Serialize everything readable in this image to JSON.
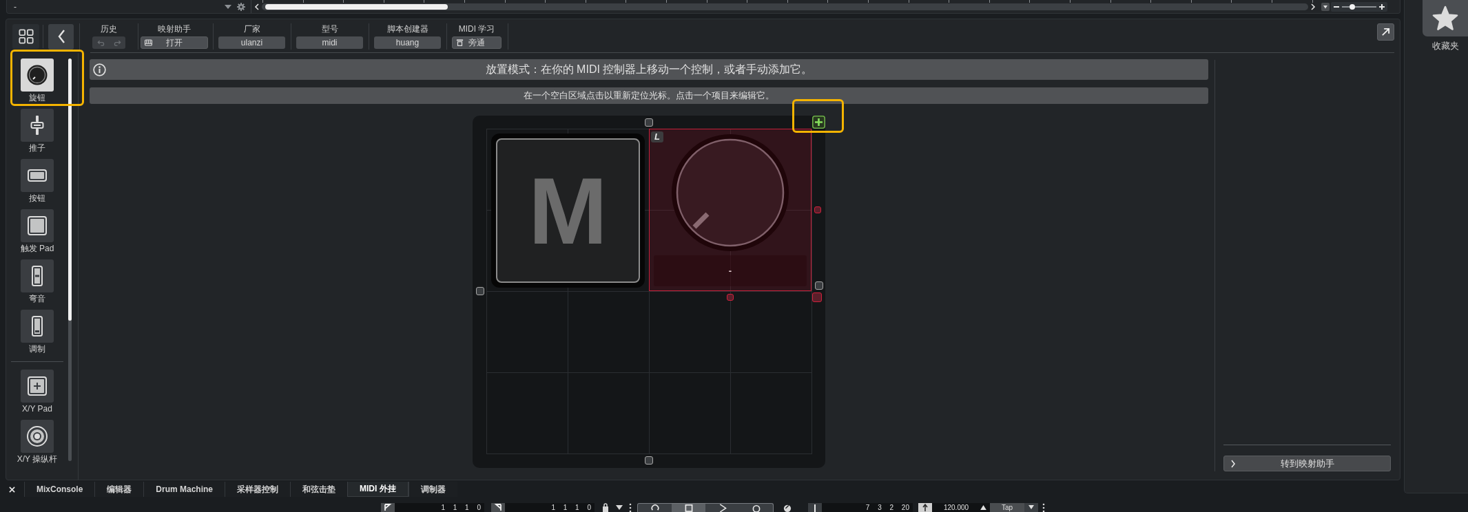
{
  "top_bar": {
    "title": "-",
    "zoom_slider": {
      "level": 0.3
    }
  },
  "favorites": {
    "label": "收藏夹"
  },
  "toolbar": {
    "groups": [
      {
        "kind": "history",
        "label": "历史",
        "disabled": true
      },
      {
        "kind": "launch",
        "label": "映射助手",
        "value": "打开"
      },
      {
        "kind": "field",
        "label": "厂家",
        "value": "ulanzi"
      },
      {
        "kind": "field",
        "label": "型号",
        "value": "midi"
      },
      {
        "kind": "field",
        "label": "脚本创建器",
        "value": "huang"
      },
      {
        "kind": "toggle",
        "label": "MIDI 学习",
        "value": "旁通"
      }
    ]
  },
  "sidebar": {
    "groups": [
      {
        "items": [
          {
            "kind": "knob",
            "label": "旋钮",
            "selected": true,
            "highlighted": true
          },
          {
            "kind": "fader",
            "label": "推子",
            "selected": false,
            "highlighted": false
          },
          {
            "kind": "button",
            "label": "按钮",
            "selected": false,
            "highlighted": false
          },
          {
            "kind": "pad",
            "label": "触发 Pad",
            "selected": false,
            "highlighted": false
          },
          {
            "kind": "pitch",
            "label": "弯音",
            "selected": false,
            "highlighted": false
          },
          {
            "kind": "modulation",
            "label": "调制",
            "selected": false,
            "highlighted": false
          }
        ]
      },
      {
        "items": [
          {
            "kind": "xy-pad",
            "label": "X/Y Pad",
            "selected": false,
            "highlighted": false
          },
          {
            "kind": "joystick",
            "label": "X/Y 操纵杆",
            "selected": false,
            "highlighted": false
          }
        ]
      }
    ]
  },
  "info": {
    "message": "放置模式：在你的 MIDI 控制器上移动一个控制，或者手动添加它。",
    "hint": "在一个空白区域点击以重新定位光标。点击一个项目来编辑它。"
  },
  "canvas": {
    "add_button": {
      "highlighted": true
    },
    "controls": [
      {
        "kind": "button",
        "label": "M",
        "selected": false
      },
      {
        "kind": "knob",
        "badge": "L",
        "label": "-",
        "selected": true
      }
    ]
  },
  "right_panel": {
    "button": "转到映射助手"
  },
  "bottom_tabs": [
    {
      "label": "MixConsole",
      "selected": false
    },
    {
      "label": "编辑器",
      "selected": false
    },
    {
      "label": "Drum Machine",
      "selected": false
    },
    {
      "label": "采样器控制",
      "selected": false
    },
    {
      "label": "和弦击垫",
      "selected": false
    },
    {
      "label": "MIDI 外挂",
      "selected": true
    },
    {
      "label": "调制器",
      "selected": false
    }
  ],
  "transport": {
    "left_locator": "1 1 1 0",
    "right_locator": "1 1 1 0",
    "buttons": [
      {
        "kind": "cycle",
        "selected": false
      },
      {
        "kind": "stop",
        "selected": true
      },
      {
        "kind": "play",
        "selected": false
      },
      {
        "kind": "record",
        "selected": false
      }
    ],
    "position": "7 3 2 20",
    "tempo": "120.000",
    "tap": "Tap"
  }
}
